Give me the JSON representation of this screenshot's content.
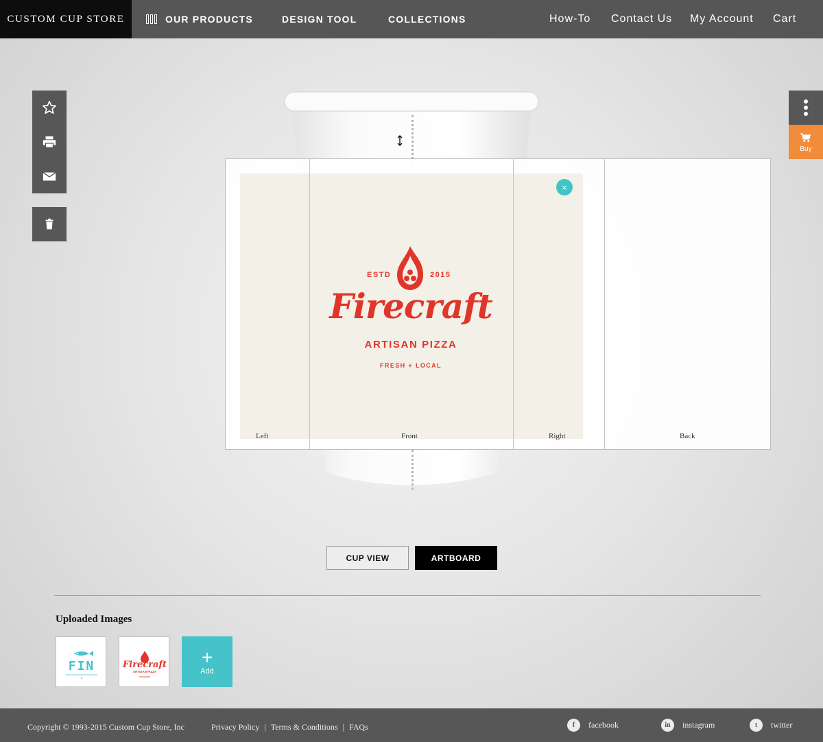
{
  "brand": "CUSTOM CUP STORE",
  "nav": {
    "products": "OUR PRODUCTS",
    "design_tool": "DESIGN TOOL",
    "collections": "COLLECTIONS",
    "howto": "How-To",
    "contact": "Contact Us",
    "account": "My Account",
    "cart": "Cart"
  },
  "left_tools": [
    "star-icon",
    "printer-icon",
    "mail-icon",
    "trash-icon"
  ],
  "right_tools": {
    "more_icon": "more-vertical-icon",
    "buy_label": "Buy"
  },
  "artboard": {
    "panels": [
      "Left",
      "Front",
      "Right",
      "Back"
    ],
    "close_symbol": "×"
  },
  "logo": {
    "estd": "ESTD",
    "year": "2015",
    "wordmark": "Firecraft",
    "subtitle": "ARTISAN PIZZA",
    "tagline": "FRESH + LOCAL",
    "color": "#e0352b"
  },
  "view_toggle": {
    "cup_view": "CUP VIEW",
    "artboard": "ARTBOARD",
    "active": "ARTBOARD"
  },
  "uploads": {
    "title": "Uploaded Images",
    "items": [
      {
        "name": "FIN",
        "color": "#45c3c8"
      },
      {
        "name": "Firecraft",
        "color": "#e0352b"
      }
    ],
    "add_label": "Add"
  },
  "footer": {
    "copyright": "Copyright © 1993-2015 Custom Cup Store, Inc",
    "links": [
      "Privacy Policy",
      "Terms & Conditions",
      "FAQs"
    ],
    "separator": "|",
    "social": [
      {
        "label": "facebook",
        "glyph": "f"
      },
      {
        "label": "instagram",
        "glyph": "in"
      },
      {
        "label": "twitter",
        "glyph": "t"
      }
    ]
  },
  "colors": {
    "accent": "#45c3c8",
    "buy": "#f08c3a",
    "dark": "#575757"
  }
}
